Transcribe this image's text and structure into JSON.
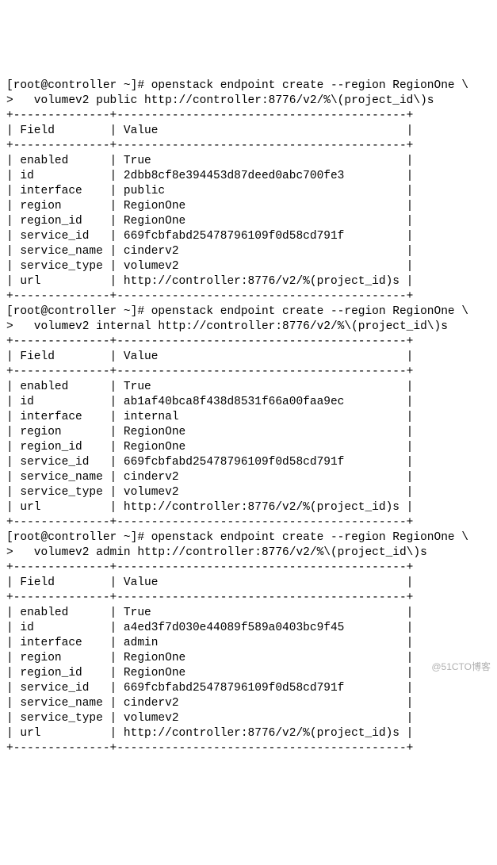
{
  "watermark": "@51CTO博客",
  "blocks": [
    {
      "prompt1": "[root@controller ~]# openstack endpoint create --region RegionOne \\",
      "prompt2": ">   volumev2 public http://controller:8776/v2/%\\(project_id\\)s",
      "sep": "+--------------+------------------------------------------+",
      "header": "| Field        | Value                                    |",
      "rows": [
        "| enabled      | True                                     |",
        "| id           | 2dbb8cf8e394453d87deed0abc700fe3         |",
        "| interface    | public                                   |",
        "| region       | RegionOne                                |",
        "| region_id    | RegionOne                                |",
        "| service_id   | 669fcbfabd25478796109f0d58cd791f         |",
        "| service_name | cinderv2                                 |",
        "| service_type | volumev2                                 |",
        "| url          | http://controller:8776/v2/%(project_id)s |"
      ]
    },
    {
      "prompt1": "[root@controller ~]# openstack endpoint create --region RegionOne \\",
      "prompt2": ">   volumev2 internal http://controller:8776/v2/%\\(project_id\\)s",
      "sep": "+--------------+------------------------------------------+",
      "header": "| Field        | Value                                    |",
      "rows": [
        "| enabled      | True                                     |",
        "| id           | ab1af40bca8f438d8531f66a00faa9ec         |",
        "| interface    | internal                                 |",
        "| region       | RegionOne                                |",
        "| region_id    | RegionOne                                |",
        "| service_id   | 669fcbfabd25478796109f0d58cd791f         |",
        "| service_name | cinderv2                                 |",
        "| service_type | volumev2                                 |",
        "| url          | http://controller:8776/v2/%(project_id)s |"
      ]
    },
    {
      "prompt1": "[root@controller ~]# openstack endpoint create --region RegionOne \\",
      "prompt2": ">   volumev2 admin http://controller:8776/v2/%\\(project_id\\)s",
      "sep": "+--------------+------------------------------------------+",
      "header": "| Field        | Value                                    |",
      "rows": [
        "| enabled      | True                                     |",
        "| id           | a4ed3f7d030e44089f589a0403bc9f45         |",
        "| interface    | admin                                    |",
        "| region       | RegionOne                                |",
        "| region_id    | RegionOne                                |",
        "| service_id   | 669fcbfabd25478796109f0d58cd791f         |",
        "| service_name | cinderv2                                 |",
        "| service_type | volumev2                                 |",
        "| url          | http://controller:8776/v2/%(project_id)s |"
      ]
    }
  ]
}
